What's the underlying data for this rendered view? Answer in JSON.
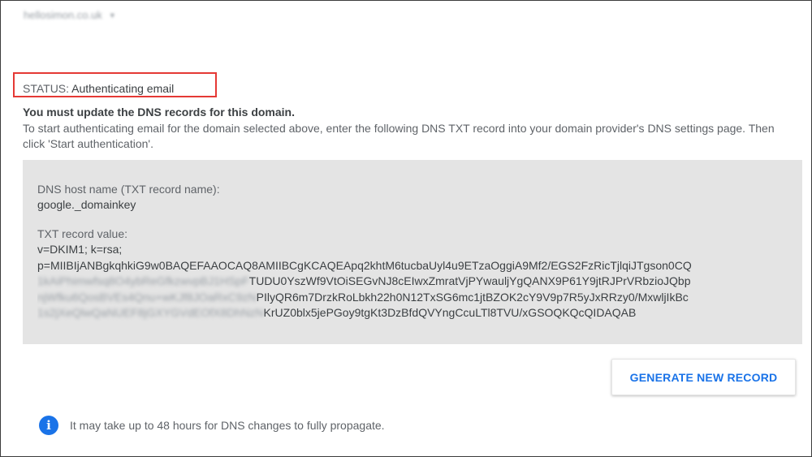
{
  "domain_selector": {
    "value": "hellosimon.co.uk",
    "icon": "caret-down-icon"
  },
  "status": {
    "label": "STATUS:",
    "value": "Authenticating email"
  },
  "notice": {
    "title": "You must update the DNS records for this domain.",
    "body": "To start authenticating email for the domain selected above, enter the following DNS TXT record into your domain provider's DNS settings page. Then click 'Start authentication'."
  },
  "record": {
    "host_label": "DNS host name (TXT record name):",
    "host_value": "google._domainkey",
    "txt_label": "TXT record value:",
    "txt_line1": "v=DKIM1; k=rsa;",
    "txt_line2": "p=MIIBIjANBgkqhkiG9w0BAQEFAAOCAQ8AMIIBCgKCAQEApq2khtM6tucbaUyl4u9ETzaOggiA9Mf2/EGS2FzRicTjlqiJTgson0CQ",
    "txt_line3_hidden": "1kAiPhimwfsq8O4ybReGfkzwvpBJ1HSpF",
    "txt_line3": "TUDU0YszWf9VtOiSEGvNJ8cEIwxZmratVjPYwauljYgQANX9P61Y9jtRJPrVRbzioJQbp",
    "txt_line4_hidden": "njWfku6QosBVEs4Qnu+wKJf8JOaRxC9zN",
    "txt_line4": "PIlyQR6m7DrzkRoLbkh22h0N12TxSG6mc1jtBZOK2cY9V9p7R5yJxRRzy0/MxwljIkBc",
    "txt_line5_hidden": "1s2jXeQlwQaNUEF8jGXYGVdEOfX8DhNzN",
    "txt_line5": "KrUZ0blx5jePGoy9tgKt3DzBfdQVYngCcuLTl8TVU/xGSOQKQcQIDAQAB"
  },
  "generate_button": {
    "label": "GENERATE NEW RECORD"
  },
  "info": {
    "icon": "info-icon",
    "text": "It may take up to 48 hours for DNS changes to fully propagate."
  },
  "colors": {
    "accent": "#1a73e8",
    "highlight": "#e53935",
    "panel": "#e4e4e4"
  }
}
